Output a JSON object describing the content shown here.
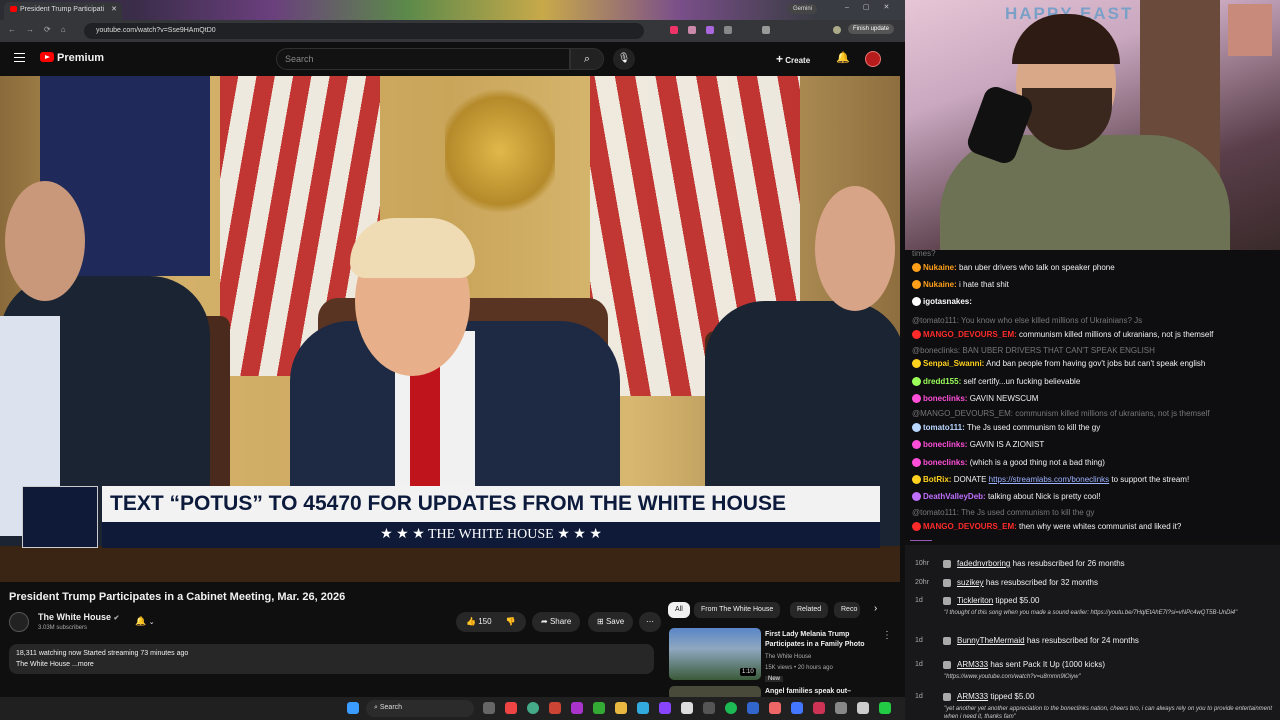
{
  "browser": {
    "tab_title": "President Trump Participati",
    "url": "youtube.com/watch?v=Sse9HAmQtD0",
    "gemini_label": "Gemini",
    "finish_update": "Finish update"
  },
  "youtube": {
    "logo_text": "Premium",
    "search_placeholder": "Search",
    "create_label": "Create",
    "lower_third_top": "TEXT “POTUS” TO 45470 FOR UPDATES FROM THE WHITE HOUSE",
    "lower_third_bottom": "★ ★ ★   THE WHITE HOUSE   ★ ★ ★",
    "video_title": "President Trump Participates in a Cabinet Meeting, Mar. 26, 2026",
    "channel_name": "The White House",
    "channel_subs": "3.03M subscribers",
    "like_count": "150",
    "share_label": "Share",
    "save_label": "Save",
    "desc_line1": "18,311 watching now  Started streaming 73 minutes ago",
    "desc_line2": "The White House ...more",
    "chips": [
      "All",
      "From The White House",
      "Related",
      "Reco"
    ],
    "rec1": {
      "title": "First Lady Melania Trump Participates in a Family Photo",
      "channel": "The White House",
      "meta": "15K views • 20 hours ago",
      "badge": "New",
      "duration": "1:10"
    },
    "rec2_title": "Angel families speak out–"
  },
  "webcam": {
    "sign_text": "HAPPY EAST"
  },
  "chat": {
    "messages": [
      {
        "user": "",
        "text": "times?",
        "reply": true
      },
      {
        "user": "Nukaine:",
        "text": "ban uber drivers who talk on speaker phone",
        "color": "#ff9f1a"
      },
      {
        "user": "Nukaine:",
        "text": "i hate that shit",
        "color": "#ff9f1a"
      },
      {
        "user": "igotasnakes:",
        "text": "",
        "color": "#ffffff"
      },
      {
        "user": "",
        "text": "@tomato111: You know who else killed millions of Ukrainians? Js",
        "reply": true
      },
      {
        "user": "MANGO_DEVOURS_EM:",
        "text": "communism killed millions of ukranians, not js themself",
        "color": "#ff2a2a"
      },
      {
        "user": "",
        "text": "@boneclinks: BAN UBER DRIVERS THAT CAN'T SPEAK ENGLISH",
        "reply": true
      },
      {
        "user": "Senpai_Swanni:",
        "text": "And ban people from having gov't jobs but can't speak english",
        "color": "#ffd21f"
      },
      {
        "user": "dredd155:",
        "text": "self certify...un fucking believable",
        "color": "#9bff5a"
      },
      {
        "user": "boneclinks:",
        "text": "GAVIN NEWSCUM",
        "color": "#ff4fd8"
      },
      {
        "user": "",
        "text": "@MANGO_DEVOURS_EM: communism killed millions of ukranians, not js themself",
        "reply": true
      },
      {
        "user": "tomato111:",
        "text": "The Js used communism to kill the gy",
        "color": "#b9d7ff"
      },
      {
        "user": "boneclinks:",
        "text": "GAVIN IS A ZIONIST",
        "color": "#ff4fd8"
      },
      {
        "user": "boneclinks:",
        "text": "(which is a good thing not a bad thing)",
        "color": "#ff4fd8"
      },
      {
        "user": "BotRix:",
        "text": "DONATE ",
        "link": "https://streamlabs.com/boneclinks",
        "after": " to support the stream!",
        "color": "#ffd21f"
      },
      {
        "user": "DeathValleyDeb:",
        "text": "talking about Nick is pretty cool!",
        "color": "#c070ff"
      },
      {
        "user": "",
        "text": "@tomato111: The Js used communism to kill the gy",
        "reply": true
      },
      {
        "user": "MANGO_DEVOURS_EM:",
        "text": "then why were whites communist and liked it?",
        "color": "#ff2a2a"
      }
    ]
  },
  "events": [
    {
      "time": "10hr",
      "user": "fadednvrboring",
      "text": "has resubscribed for 26 months"
    },
    {
      "time": "20hr",
      "user": "suzikey",
      "text": "has resubscribed for 32 months"
    },
    {
      "time": "1d",
      "user": "Tickleriton",
      "text": "tipped $5.00",
      "detail": "\"I thought of this song when you made a sound earlier: https://youtu.be/7HqlEtAhE7I?si=vNPc4wQT5B-UnDi4\""
    },
    {
      "time": "1d",
      "user": "BunnyTheMermaid",
      "text": "has resubscribed for 24 months"
    },
    {
      "time": "1d",
      "user": "ARM333",
      "text": "has sent Pack It Up (1000 kicks)",
      "detail": "\"https://www.youtube.com/watch?v=u8rnmn9lOiyw\""
    },
    {
      "time": "1d",
      "user": "ARM333",
      "text": "tipped $5.00",
      "detail": "\"yet another yet another appreciation to the boneclinks nation, cheers bro, i can always rely on you to provide entertainment when i need it, thanks fam\""
    }
  ],
  "taskbar": {
    "search_label": "Search"
  }
}
